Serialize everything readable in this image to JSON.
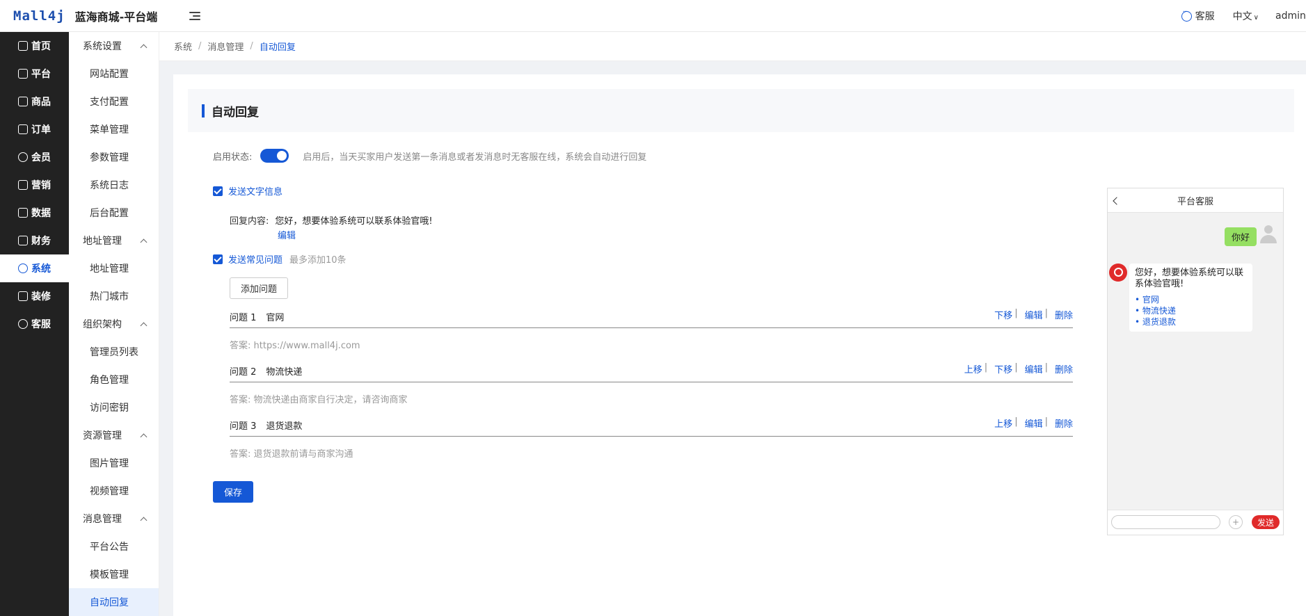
{
  "header": {
    "logo": "Mall4j",
    "app_title": "蓝海商城-平台端",
    "customer_service": "客服",
    "language": "中文",
    "user": "admin"
  },
  "main_nav": {
    "items": [
      {
        "label": "首页"
      },
      {
        "label": "平台"
      },
      {
        "label": "商品"
      },
      {
        "label": "订单"
      },
      {
        "label": "会员"
      },
      {
        "label": "营销"
      },
      {
        "label": "数据"
      },
      {
        "label": "财务"
      },
      {
        "label": "系统"
      },
      {
        "label": "装修"
      },
      {
        "label": "客服"
      }
    ]
  },
  "sub_nav": {
    "groups": [
      {
        "label": "系统设置",
        "items": [
          "网站配置",
          "支付配置",
          "菜单管理",
          "参数管理",
          "系统日志",
          "后台配置"
        ]
      },
      {
        "label": "地址管理",
        "items": [
          "地址管理",
          "热门城市"
        ]
      },
      {
        "label": "组织架构",
        "items": [
          "管理员列表",
          "角色管理",
          "访问密钥"
        ]
      },
      {
        "label": "资源管理",
        "items": [
          "图片管理",
          "视频管理"
        ]
      },
      {
        "label": "消息管理",
        "items": [
          "平台公告",
          "模板管理",
          "自动回复"
        ]
      }
    ]
  },
  "breadcrumb": [
    "系统",
    "消息管理",
    "自动回复"
  ],
  "page": {
    "title": "自动回复",
    "enable_label": "启用状态:",
    "enable_hint": "启用后，当天买家用户发送第一条消息或者发消息时无客服在线，系统会自动进行回复",
    "send_text_label": "发送文字信息",
    "reply_label": "回复内容:",
    "reply_value": "您好，想要体验系统可以联系体验官哦!",
    "edit_label": "编辑",
    "send_faq_label": "发送常见问题",
    "faq_max": "最多添加10条",
    "add_question": "添加问题",
    "ops": {
      "up": "上移",
      "down": "下移",
      "edit": "编辑",
      "delete": "删除"
    },
    "questions": [
      {
        "no": "问题 1",
        "title": "官网",
        "answer": "答案: https://www.mall4j.com"
      },
      {
        "no": "问题 2",
        "title": "物流快递",
        "answer": "答案: 物流快递由商家自行决定，请咨询商家"
      },
      {
        "no": "问题 3",
        "title": "退货退款",
        "answer": "答案: 退货退款前请与商家沟通"
      }
    ],
    "save": "保存"
  },
  "preview": {
    "title": "平台客服",
    "user_msg": "你好",
    "bot_msg": "您好，想要体验系统可以联系体验官哦!",
    "options": [
      "• 官网",
      "• 物流快递",
      "• 退货退款"
    ],
    "plus": "+",
    "send": "发送"
  }
}
